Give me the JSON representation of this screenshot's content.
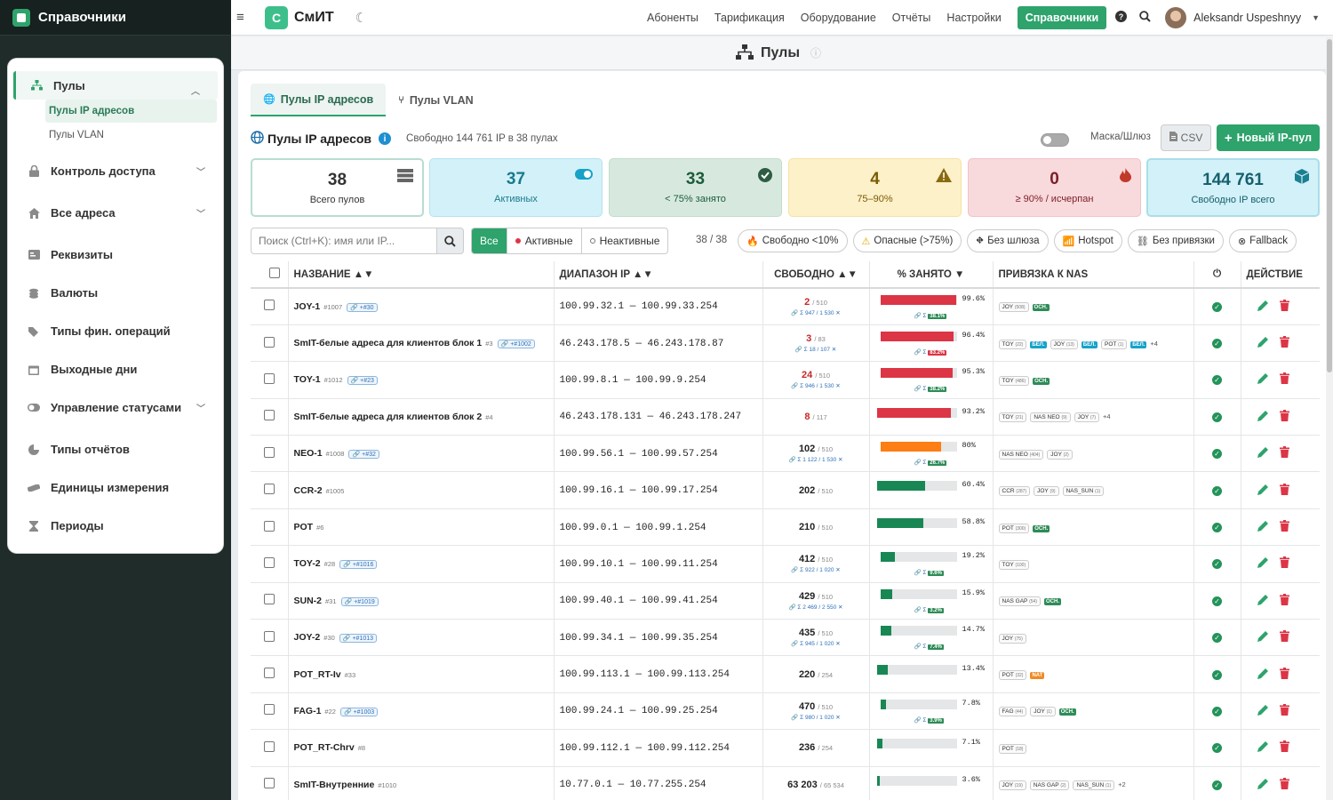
{
  "sidebar": {
    "title": "Справочники",
    "items": [
      {
        "label": "Пулы",
        "subs": [
          "Пулы IP адресов",
          "Пулы VLAN"
        ]
      },
      {
        "label": "Контроль доступа"
      },
      {
        "label": "Все адреса"
      },
      {
        "label": "Реквизиты"
      },
      {
        "label": "Валюты"
      },
      {
        "label": "Типы фин. операций"
      },
      {
        "label": "Выходные дни"
      },
      {
        "label": "Управление статусами"
      },
      {
        "label": "Типы отчётов"
      },
      {
        "label": "Единицы измерения"
      },
      {
        "label": "Периоды"
      }
    ]
  },
  "topbar": {
    "brand_letter": "С",
    "brand": "СмИТ",
    "nav": [
      "Абоненты",
      "Тарификация",
      "Оборудование",
      "Отчёты",
      "Настройки",
      "Справочники"
    ],
    "user": "Aleksandr Uspeshnyy"
  },
  "page": {
    "title": "Пулы"
  },
  "tabs": [
    "Пулы IP адресов",
    "Пулы VLAN"
  ],
  "section": {
    "title": "Пулы IP адресов",
    "summary": "Свободно 144 761 IP в 38 пулах",
    "mask_label": "Маска/Шлюз",
    "csv": "CSV",
    "new_button": "Новый IP-пул"
  },
  "stats": [
    {
      "value": "38",
      "label": "Всего пулов",
      "icon": "server-icon",
      "bg": "#ffffff",
      "border": "#b8ddd0",
      "color": "#333333"
    },
    {
      "value": "37",
      "label": "Активных",
      "icon": "toggle-icon",
      "bg": "#d3f1f8",
      "border": "#b3e3ef",
      "color": "#187a8c"
    },
    {
      "value": "33",
      "label": "< 75% занято",
      "icon": "check-circle-icon",
      "bg": "#d7e9de",
      "border": "#c2dccb",
      "color": "#1d5c3a"
    },
    {
      "value": "4",
      "label": "75–90%",
      "icon": "warning-icon",
      "bg": "#fdf1c9",
      "border": "#f4e2a6",
      "color": "#7a5b08"
    },
    {
      "value": "0",
      "label": "≥ 90% / исчерпан",
      "icon": "fire-icon",
      "bg": "#f8d9dc",
      "border": "#efc3c8",
      "color": "#7c1f28"
    },
    {
      "value": "144 761",
      "label": "Свободно IP всего",
      "icon": "cube-icon",
      "bg": "#d3f1f8",
      "border": "#a9deea",
      "color": "#16606e"
    }
  ],
  "filters": {
    "search_placeholder": "Поиск (Ctrl+K): имя или IP...",
    "segments": [
      "Все",
      "Активные",
      "Неактивные"
    ],
    "count": "38 / 38",
    "chips": [
      "Свободно <10%",
      "Опасные (>75%)",
      "Без шлюза",
      "Hotspot",
      "Без привязки",
      "Fallback"
    ]
  },
  "table": {
    "headers": [
      "НАЗВАНИЕ ▲▼",
      "ДИАПАЗОН IP ▲▼",
      "СВОБОДНО ▲▼",
      "% ЗАНЯТО ▼",
      "ПРИВЯЗКА К NAS",
      "ДЕЙСТВИЕ"
    ],
    "rows": [
      {
        "name": "JOY-1",
        "id": "#1007",
        "link": "🔗 +#30",
        "range": "100.99.32.1 — 100.99.33.254",
        "free": "2",
        "total": "/ 510",
        "sum": "🔗 Σ 947 / 1 530 ✕",
        "pct": 99.6,
        "pct_text": "99.6%",
        "sub": "🔗 Σ",
        "sub_val": "38.1%",
        "sub_red": false,
        "nas": [
          [
            "JOY",
            "508"
          ]
        ],
        "badges": [
          "ОСН."
        ],
        "more": ""
      },
      {
        "name": "SmIT-белые адреса для клиентов блок 1",
        "id": "#3",
        "link": "🔗 +#1002",
        "range": "46.243.178.5 — 46.243.178.87",
        "free": "3",
        "total": "/ 83",
        "sum": "🔗 Σ 18 / 107 ✕",
        "pct": 96.4,
        "pct_text": "96.4%",
        "sub": "🔗 Σ",
        "sub_val": "83.2%",
        "sub_red": true,
        "nas": [
          [
            "TOY",
            "22"
          ],
          [
            "JOY",
            "13"
          ],
          [
            "POT",
            "1"
          ]
        ],
        "badges": [
          "БЕЛ."
        ],
        "more": "+4"
      },
      {
        "name": "TOY-1",
        "id": "#1012",
        "link": "🔗 +#23",
        "range": "100.99.8.1 — 100.99.9.254",
        "free": "24",
        "total": "/ 510",
        "sum": "🔗 Σ 946 / 1 530 ✕",
        "pct": 95.3,
        "pct_text": "95.3%",
        "sub": "🔗 Σ",
        "sub_val": "38.2%",
        "sub_red": false,
        "nas": [
          [
            "TOY",
            "486"
          ]
        ],
        "badges": [
          "ОСН."
        ],
        "more": ""
      },
      {
        "name": "SmIT-белые адреса для клиентов блок 2",
        "id": "#4",
        "link": "",
        "range": "46.243.178.131 — 46.243.178.247",
        "free": "8",
        "total": "/ 117",
        "sum": "",
        "pct": 93.2,
        "pct_text": "93.2%",
        "sub": "",
        "sub_val": "",
        "sub_red": false,
        "nas": [
          [
            "TOY",
            "21"
          ],
          [
            "NAS NEO",
            "9"
          ],
          [
            "JOY",
            "7"
          ]
        ],
        "badges": [],
        "more": "+4"
      },
      {
        "name": "NEO-1",
        "id": "#1008",
        "link": "🔗 +#32",
        "range": "100.99.56.1 — 100.99.57.254",
        "free": "102",
        "total": "/ 510",
        "sum": "🔗 Σ 1 122 / 1 530 ✕",
        "pct": 80,
        "pct_text": "80%",
        "sub": "🔗 Σ",
        "sub_val": "26.7%",
        "sub_red": false,
        "nas": [
          [
            "NAS NEO",
            "404"
          ],
          [
            "JOY",
            "2"
          ]
        ],
        "badges": [],
        "more": ""
      },
      {
        "name": "CCR-2",
        "id": "#1005",
        "link": "",
        "range": "100.99.16.1 — 100.99.17.254",
        "free": "202",
        "total": "/ 510",
        "sum": "",
        "pct": 60.4,
        "pct_text": "60.4%",
        "sub": "",
        "sub_val": "",
        "sub_red": false,
        "nas": [
          [
            "CCR",
            "287"
          ],
          [
            "JOY",
            "9"
          ],
          [
            "NAS_SUN",
            "1"
          ]
        ],
        "badges": [],
        "more": ""
      },
      {
        "name": "POT",
        "id": "#6",
        "link": "",
        "range": "100.99.0.1 — 100.99.1.254",
        "free": "210",
        "total": "/ 510",
        "sum": "",
        "pct": 58.8,
        "pct_text": "58.8%",
        "sub": "",
        "sub_val": "",
        "sub_red": false,
        "nas": [
          [
            "POT",
            "300"
          ]
        ],
        "badges": [
          "ОСН."
        ],
        "more": ""
      },
      {
        "name": "TOY-2",
        "id": "#28",
        "link": "🔗 +#1016",
        "range": "100.99.10.1 — 100.99.11.254",
        "free": "412",
        "total": "/ 510",
        "sum": "🔗 Σ 922 / 1 020 ✕",
        "pct": 19.2,
        "pct_text": "19.2%",
        "sub": "🔗 Σ",
        "sub_val": "9.6%",
        "sub_red": false,
        "nas": [
          [
            "TOY",
            "100"
          ]
        ],
        "badges": [],
        "more": ""
      },
      {
        "name": "SUN-2",
        "id": "#31",
        "link": "🔗 +#1019",
        "range": "100.99.40.1 — 100.99.41.254",
        "free": "429",
        "total": "/ 510",
        "sum": "🔗 Σ 2 469 / 2 550 ✕",
        "pct": 15.9,
        "pct_text": "15.9%",
        "sub": "🔗 Σ",
        "sub_val": "3.2%",
        "sub_red": false,
        "nas": [
          [
            "NAS GAP",
            "54"
          ]
        ],
        "badges": [
          "ОСН."
        ],
        "more": ""
      },
      {
        "name": "JOY-2",
        "id": "#30",
        "link": "🔗 +#1013",
        "range": "100.99.34.1 — 100.99.35.254",
        "free": "435",
        "total": "/ 510",
        "sum": "🔗 Σ 945 / 1 020 ✕",
        "pct": 14.7,
        "pct_text": "14.7%",
        "sub": "🔗 Σ",
        "sub_val": "7.4%",
        "sub_red": false,
        "nas": [
          [
            "JOY",
            "75"
          ]
        ],
        "badges": [],
        "more": ""
      },
      {
        "name": "POT_RT-Iv",
        "id": "#33",
        "link": "",
        "range": "100.99.113.1 — 100.99.113.254",
        "free": "220",
        "total": "/ 254",
        "sum": "",
        "pct": 13.4,
        "pct_text": "13.4%",
        "sub": "",
        "sub_val": "",
        "sub_red": false,
        "nas": [
          [
            "POT",
            "32"
          ]
        ],
        "badges": [
          "NAT"
        ],
        "more": ""
      },
      {
        "name": "FAG-1",
        "id": "#22",
        "link": "🔗 +#1003",
        "range": "100.99.24.1 — 100.99.25.254",
        "free": "470",
        "total": "/ 510",
        "sum": "🔗 Σ 980 / 1 020 ✕",
        "pct": 7.8,
        "pct_text": "7.8%",
        "sub": "🔗 Σ",
        "sub_val": "3.9%",
        "sub_red": false,
        "nas": [
          [
            "FAG",
            "44"
          ],
          [
            "JOY",
            "1"
          ]
        ],
        "badges": [
          "ОСН."
        ],
        "more": ""
      },
      {
        "name": "POT_RT-Chrv",
        "id": "#8",
        "link": "",
        "range": "100.99.112.1 — 100.99.112.254",
        "free": "236",
        "total": "/ 254",
        "sum": "",
        "pct": 7.1,
        "pct_text": "7.1%",
        "sub": "",
        "sub_val": "",
        "sub_red": false,
        "nas": [
          [
            "POT",
            "18"
          ]
        ],
        "badges": [],
        "more": ""
      },
      {
        "name": "SmIT-Внутренние",
        "id": "#1010",
        "link": "",
        "range": "10.77.0.1 — 10.77.255.254",
        "free": "63 203",
        "total": "/ 65 534",
        "sum": "",
        "pct": 3.6,
        "pct_text": "3.6%",
        "sub": "",
        "sub_val": "",
        "sub_red": false,
        "nas": [
          [
            "JOY",
            "19"
          ],
          [
            "NAS GAP",
            "2"
          ],
          [
            "NAS_SUN",
            "1"
          ]
        ],
        "badges": [],
        "more": "+2"
      }
    ]
  },
  "colors": {
    "accent": "#2ea36c",
    "red": "#dc3545",
    "orange": "#fd7e14",
    "green_bar": "#198754"
  }
}
